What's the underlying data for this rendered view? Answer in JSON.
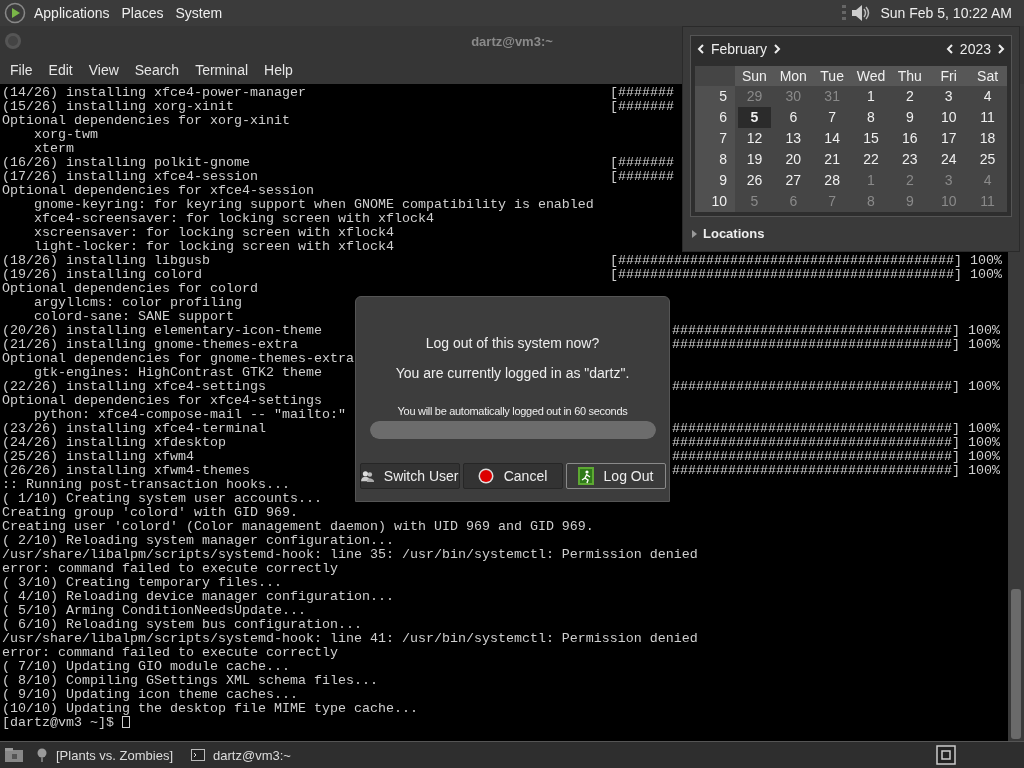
{
  "top_panel": {
    "menus": [
      "Applications",
      "Places",
      "System"
    ],
    "clock": "Sun Feb  5, 10:22 AM"
  },
  "terminal_window": {
    "title": "dartz@vm3:~",
    "menu": [
      "File",
      "Edit",
      "View",
      "Search",
      "Terminal",
      "Help"
    ],
    "lines": [
      {
        "text": "(14/26) installing xfce4-power-manager",
        "bar": "[#######"
      },
      {
        "text": "(15/26) installing xorg-xinit",
        "bar": "[#######"
      },
      {
        "text": "Optional dependencies for xorg-xinit"
      },
      {
        "text": "    xorg-twm"
      },
      {
        "text": "    xterm"
      },
      {
        "text": "(16/26) installing polkit-gnome",
        "bar": "[#######"
      },
      {
        "text": "(17/26) installing xfce4-session",
        "bar": "[#######"
      },
      {
        "text": "Optional dependencies for xfce4-session"
      },
      {
        "text": "    gnome-keyring: for keyring support when GNOME compatibility is enabled"
      },
      {
        "text": "    xfce4-screensaver: for locking screen with xflock4"
      },
      {
        "text": "    xscreensaver: for locking screen with xflock4"
      },
      {
        "text": "    light-locker: for locking screen with xflock4"
      },
      {
        "text": "(18/26) installing libgusb",
        "bar": "[##########################################] 100%"
      },
      {
        "text": "(19/26) installing colord",
        "bar": "[##########################################] 100%"
      },
      {
        "text": "Optional dependencies for colord"
      },
      {
        "text": "    argyllcms: color profiling"
      },
      {
        "text": "    colord-sane: SANE support"
      },
      {
        "text": "(20/26) installing elementary-icon-theme",
        "bar_tail": "###################################] 100%"
      },
      {
        "text": "(21/26) installing gnome-themes-extra",
        "bar_tail": "###################################] 100%"
      },
      {
        "text": "Optional dependencies for gnome-themes-extra"
      },
      {
        "text": "    gtk-engines: HighContrast GTK2 theme"
      },
      {
        "text": "(22/26) installing xfce4-settings",
        "bar_tail": "###################################] 100%"
      },
      {
        "text": "Optional dependencies for xfce4-settings"
      },
      {
        "text": "    python: xfce4-compose-mail -- \"mailto:\""
      },
      {
        "text": "(23/26) installing xfce4-terminal",
        "bar_tail": "###################################] 100%"
      },
      {
        "text": "(24/26) installing xfdesktop",
        "bar_tail": "###################################] 100%"
      },
      {
        "text": "(25/26) installing xfwm4",
        "bar_tail": "###################################] 100%"
      },
      {
        "text": "(26/26) installing xfwm4-themes",
        "bar_tail": "###################################] 100%"
      },
      {
        "text": ":: Running post-transaction hooks..."
      },
      {
        "text": "( 1/10) Creating system user accounts..."
      },
      {
        "text": "Creating group 'colord' with GID 969."
      },
      {
        "text": "Creating user 'colord' (Color management daemon) with UID 969 and GID 969."
      },
      {
        "text": "( 2/10) Reloading system manager configuration..."
      },
      {
        "text": "/usr/share/libalpm/scripts/systemd-hook: line 35: /usr/bin/systemctl: Permission denied"
      },
      {
        "text": "error: command failed to execute correctly"
      },
      {
        "text": "( 3/10) Creating temporary files..."
      },
      {
        "text": "( 4/10) Reloading device manager configuration..."
      },
      {
        "text": "( 5/10) Arming ConditionNeedsUpdate..."
      },
      {
        "text": "( 6/10) Reloading system bus configuration..."
      },
      {
        "text": "/usr/share/libalpm/scripts/systemd-hook: line 41: /usr/bin/systemctl: Permission denied"
      },
      {
        "text": "error: command failed to execute correctly"
      },
      {
        "text": "( 7/10) Updating GIO module cache..."
      },
      {
        "text": "( 8/10) Compiling GSettings XML schema files..."
      },
      {
        "text": "( 9/10) Updating icon theme caches..."
      },
      {
        "text": "(10/10) Updating the desktop file MIME type cache..."
      }
    ],
    "prompt": "[dartz@vm3 ~]$ "
  },
  "calendar": {
    "month": "February",
    "year": "2023",
    "weekdays": [
      "Sun",
      "Mon",
      "Tue",
      "Wed",
      "Thu",
      "Fri",
      "Sat"
    ],
    "weeks": [
      {
        "week": "5",
        "days": [
          {
            "day": "29",
            "in_month": false,
            "selected": false
          },
          {
            "day": "30",
            "in_month": false,
            "selected": false
          },
          {
            "day": "31",
            "in_month": false,
            "selected": false
          },
          {
            "day": "1",
            "in_month": true,
            "selected": false
          },
          {
            "day": "2",
            "in_month": true,
            "selected": false
          },
          {
            "day": "3",
            "in_month": true,
            "selected": false
          },
          {
            "day": "4",
            "in_month": true,
            "selected": false
          }
        ]
      },
      {
        "week": "6",
        "days": [
          {
            "day": "5",
            "in_month": true,
            "selected": true
          },
          {
            "day": "6",
            "in_month": true,
            "selected": false
          },
          {
            "day": "7",
            "in_month": true,
            "selected": false
          },
          {
            "day": "8",
            "in_month": true,
            "selected": false
          },
          {
            "day": "9",
            "in_month": true,
            "selected": false
          },
          {
            "day": "10",
            "in_month": true,
            "selected": false
          },
          {
            "day": "11",
            "in_month": true,
            "selected": false
          }
        ]
      },
      {
        "week": "7",
        "days": [
          {
            "day": "12",
            "in_month": true,
            "selected": false
          },
          {
            "day": "13",
            "in_month": true,
            "selected": false
          },
          {
            "day": "14",
            "in_month": true,
            "selected": false
          },
          {
            "day": "15",
            "in_month": true,
            "selected": false
          },
          {
            "day": "16",
            "in_month": true,
            "selected": false
          },
          {
            "day": "17",
            "in_month": true,
            "selected": false
          },
          {
            "day": "18",
            "in_month": true,
            "selected": false
          }
        ]
      },
      {
        "week": "8",
        "days": [
          {
            "day": "19",
            "in_month": true,
            "selected": false
          },
          {
            "day": "20",
            "in_month": true,
            "selected": false
          },
          {
            "day": "21",
            "in_month": true,
            "selected": false
          },
          {
            "day": "22",
            "in_month": true,
            "selected": false
          },
          {
            "day": "23",
            "in_month": true,
            "selected": false
          },
          {
            "day": "24",
            "in_month": true,
            "selected": false
          },
          {
            "day": "25",
            "in_month": true,
            "selected": false
          }
        ]
      },
      {
        "week": "9",
        "days": [
          {
            "day": "26",
            "in_month": true,
            "selected": false
          },
          {
            "day": "27",
            "in_month": true,
            "selected": false
          },
          {
            "day": "28",
            "in_month": true,
            "selected": false
          },
          {
            "day": "1",
            "in_month": false,
            "selected": false
          },
          {
            "day": "2",
            "in_month": false,
            "selected": false
          },
          {
            "day": "3",
            "in_month": false,
            "selected": false
          },
          {
            "day": "4",
            "in_month": false,
            "selected": false
          }
        ]
      },
      {
        "week": "10",
        "days": [
          {
            "day": "5",
            "in_month": false,
            "selected": false
          },
          {
            "day": "6",
            "in_month": false,
            "selected": false
          },
          {
            "day": "7",
            "in_month": false,
            "selected": false
          },
          {
            "day": "8",
            "in_month": false,
            "selected": false
          },
          {
            "day": "9",
            "in_month": false,
            "selected": false
          },
          {
            "day": "10",
            "in_month": false,
            "selected": false
          },
          {
            "day": "11",
            "in_month": false,
            "selected": false
          }
        ]
      }
    ],
    "locations": {
      "label": "Locations",
      "expanded": false
    }
  },
  "logout_dialog": {
    "question": "Log out of this system now?",
    "info": "You are currently logged in as \"dartz\".",
    "countdown": "You will be automatically logged out in 60 seconds",
    "level": 1,
    "buttons": [
      {
        "kind": "switch_user",
        "label": "Switch User",
        "focused": false
      },
      {
        "kind": "cancel",
        "label": "Cancel",
        "focused": false
      },
      {
        "kind": "logout",
        "label": "Log Out",
        "focused": true
      }
    ]
  },
  "taskbar": {
    "tasks": [
      {
        "kind": "game",
        "label": "[Plants vs. Zombies]"
      },
      {
        "kind": "terminal",
        "label": "dartz@vm3:~"
      }
    ]
  }
}
